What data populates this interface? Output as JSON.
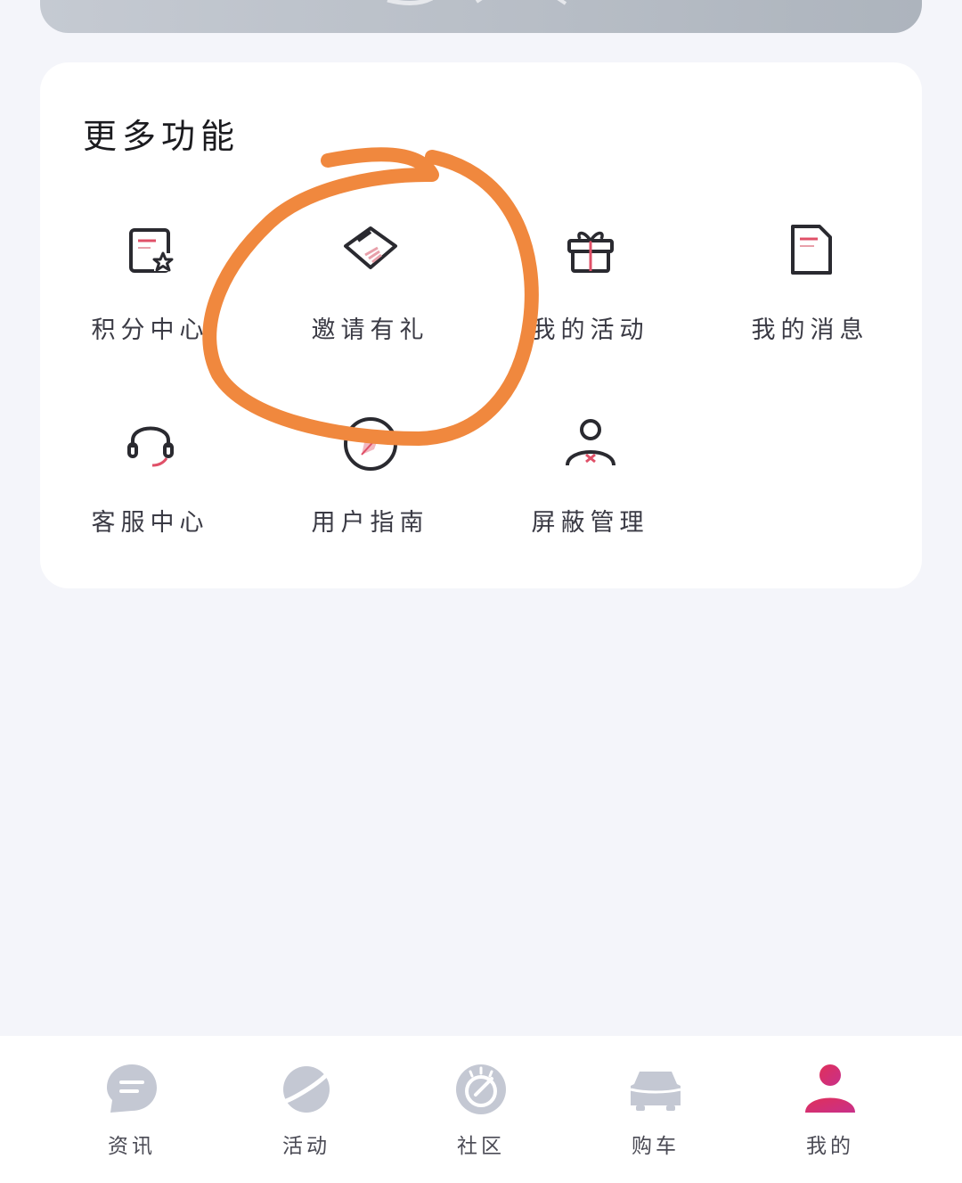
{
  "section": {
    "title": "更多功能",
    "items": [
      {
        "label": "积分中心",
        "icon": "points-certificate-icon"
      },
      {
        "label": "邀请有礼",
        "icon": "handshake-icon"
      },
      {
        "label": "我的活动",
        "icon": "gift-icon"
      },
      {
        "label": "我的消息",
        "icon": "message-document-icon"
      },
      {
        "label": "客服中心",
        "icon": "headset-icon"
      },
      {
        "label": "用户指南",
        "icon": "compass-icon"
      },
      {
        "label": "屏蔽管理",
        "icon": "user-block-icon"
      }
    ]
  },
  "tabbar": {
    "items": [
      {
        "label": "资讯",
        "icon": "chat-bubble-icon",
        "active": false
      },
      {
        "label": "活动",
        "icon": "planet-icon",
        "active": false
      },
      {
        "label": "社区",
        "icon": "community-icon",
        "active": false
      },
      {
        "label": "购车",
        "icon": "car-icon",
        "active": false
      },
      {
        "label": "我的",
        "icon": "user-icon",
        "active": true
      }
    ]
  },
  "colors": {
    "page_bg": "#f4f5fa",
    "accent_red": "#e05068",
    "annotation_orange": "#f0883e",
    "tab_inactive": "#c4c8d3",
    "tab_active_start": "#e0305a",
    "tab_active_end": "#c8308a"
  }
}
